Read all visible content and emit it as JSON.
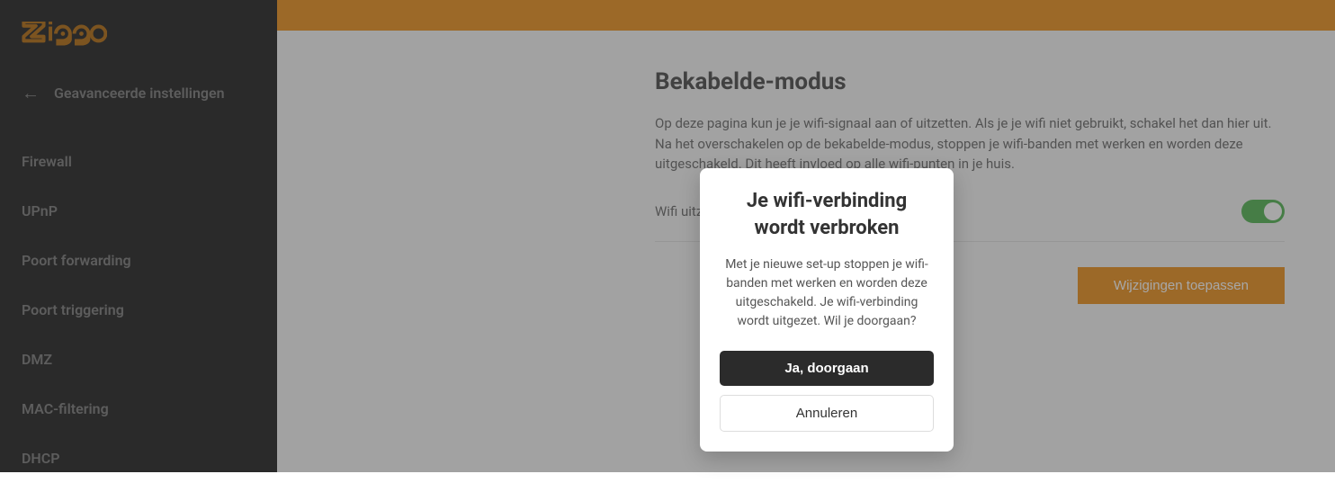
{
  "logo": {
    "text": "ziggo"
  },
  "sidebar": {
    "back_label": "Geavanceerde instellingen",
    "items": [
      {
        "label": "Firewall"
      },
      {
        "label": "UPnP"
      },
      {
        "label": "Poort forwarding"
      },
      {
        "label": "Poort triggering"
      },
      {
        "label": "DMZ"
      },
      {
        "label": "MAC-filtering"
      },
      {
        "label": "DHCP"
      }
    ]
  },
  "main": {
    "title": "Bekabelde-modus",
    "description": "Op deze pagina kun je je wifi-signaal aan of uitzetten. Als je je wifi niet gebruikt, schakel het dan hier uit. Na het overschakelen op de bekabelde-modus, stoppen je wifi-banden met werken en worden deze uitgeschakeld. Dit heeft invloed op alle wifi-punten in je huis.",
    "toggle_label": "Wifi uitzetten",
    "apply_button_label": "Wijzigingen toepassen"
  },
  "modal": {
    "title": "Je wifi-verbinding wordt verbroken",
    "body": "Met je nieuwe set-up stoppen je wifi-banden met werken en worden deze uitgeschakeld. Je wifi-verbinding wordt uitgezet. Wil je doorgaan?",
    "confirm_label": "Ja, doorgaan",
    "cancel_label": "Annuleren"
  }
}
